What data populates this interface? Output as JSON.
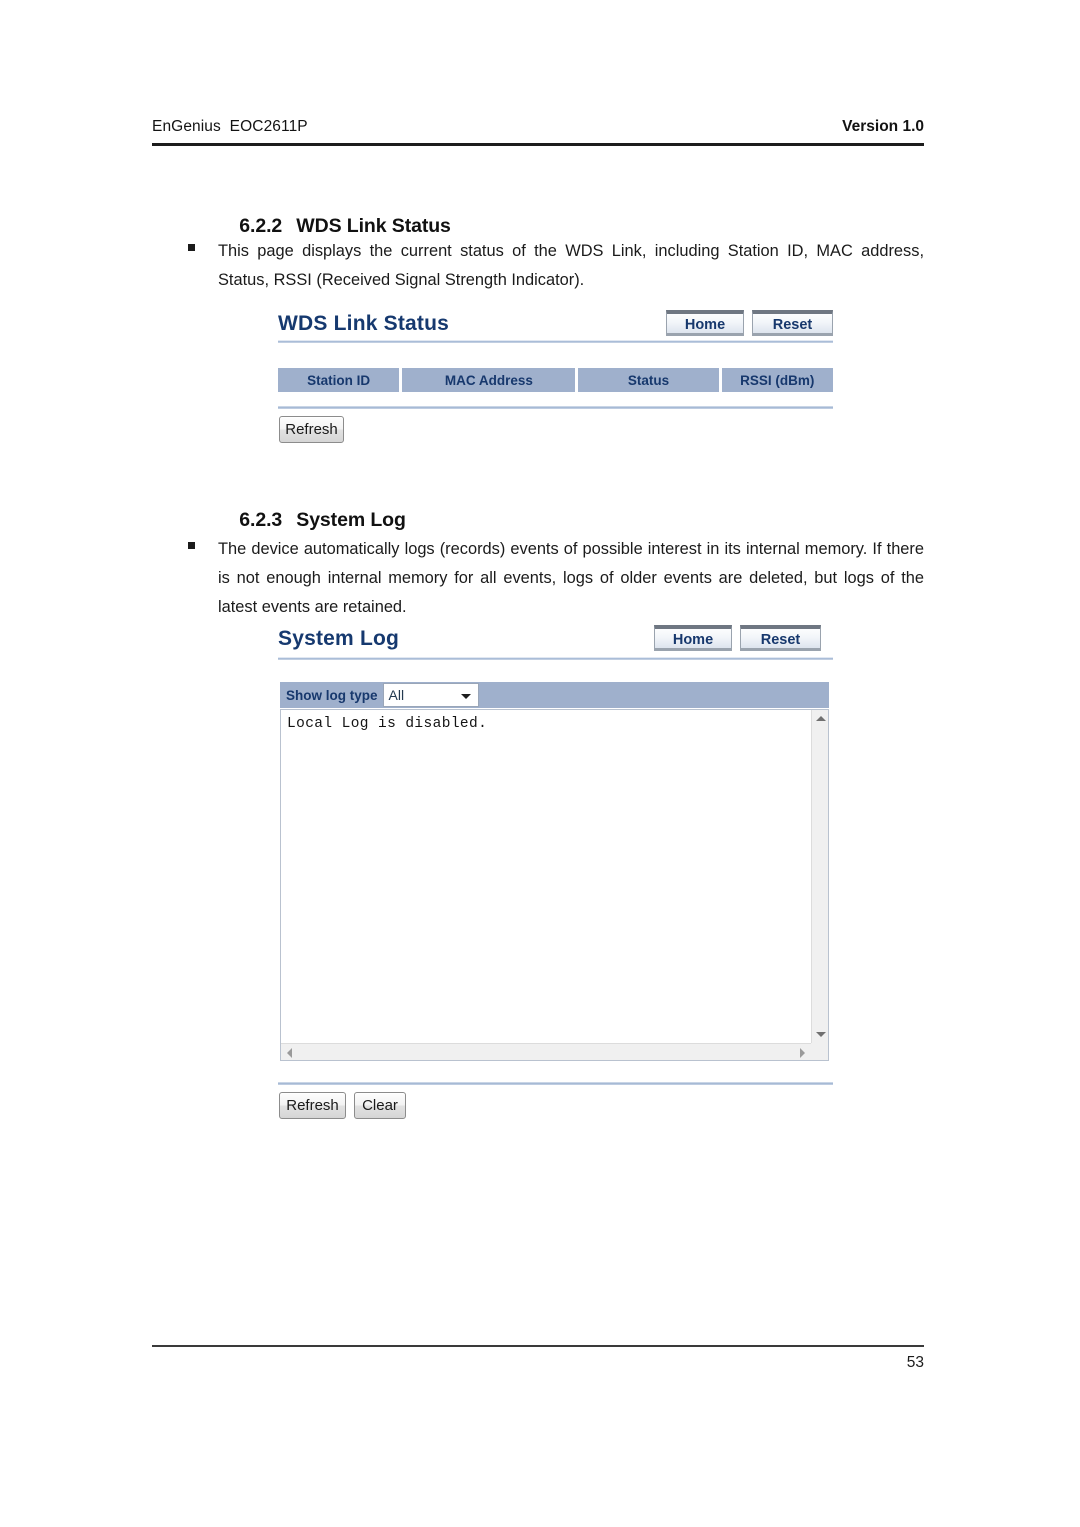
{
  "document": {
    "header_left": "EnGenius  EOC2611P",
    "header_right": "Version 1.0",
    "page_number": "53"
  },
  "sections": [
    {
      "number": "6.2.2",
      "title": "WDS Link Status",
      "body": "This page displays the current status of the WDS Link, including Station ID, MAC address, Status, RSSI (Received Signal Strength Indicator)."
    },
    {
      "number": "6.2.3",
      "title": "System Log",
      "body": "The device automatically logs (records) events of possible interest in its internal memory. If there is not enough internal memory for all events, logs of older events are deleted, but logs of the latest events are retained."
    }
  ],
  "wds_panel": {
    "title": "WDS Link Status",
    "home_label": "Home",
    "reset_label": "Reset",
    "table": {
      "columns": [
        "Station ID",
        "MAC Address",
        "Status",
        "RSSI (dBm)"
      ],
      "rows": []
    },
    "refresh_label": "Refresh"
  },
  "syslog_panel": {
    "title": "System Log",
    "home_label": "Home",
    "reset_label": "Reset",
    "log_type_label": "Show log type",
    "log_type_value": "All",
    "log_type_options": [
      "All"
    ],
    "log_content": "Local Log is disabled.",
    "refresh_label": "Refresh",
    "clear_label": "Clear"
  },
  "colors": {
    "panel_title": "#16396f",
    "table_header_bg": "#9fb0cc",
    "table_header_text": "#17386d",
    "button_text": "#17386d"
  }
}
